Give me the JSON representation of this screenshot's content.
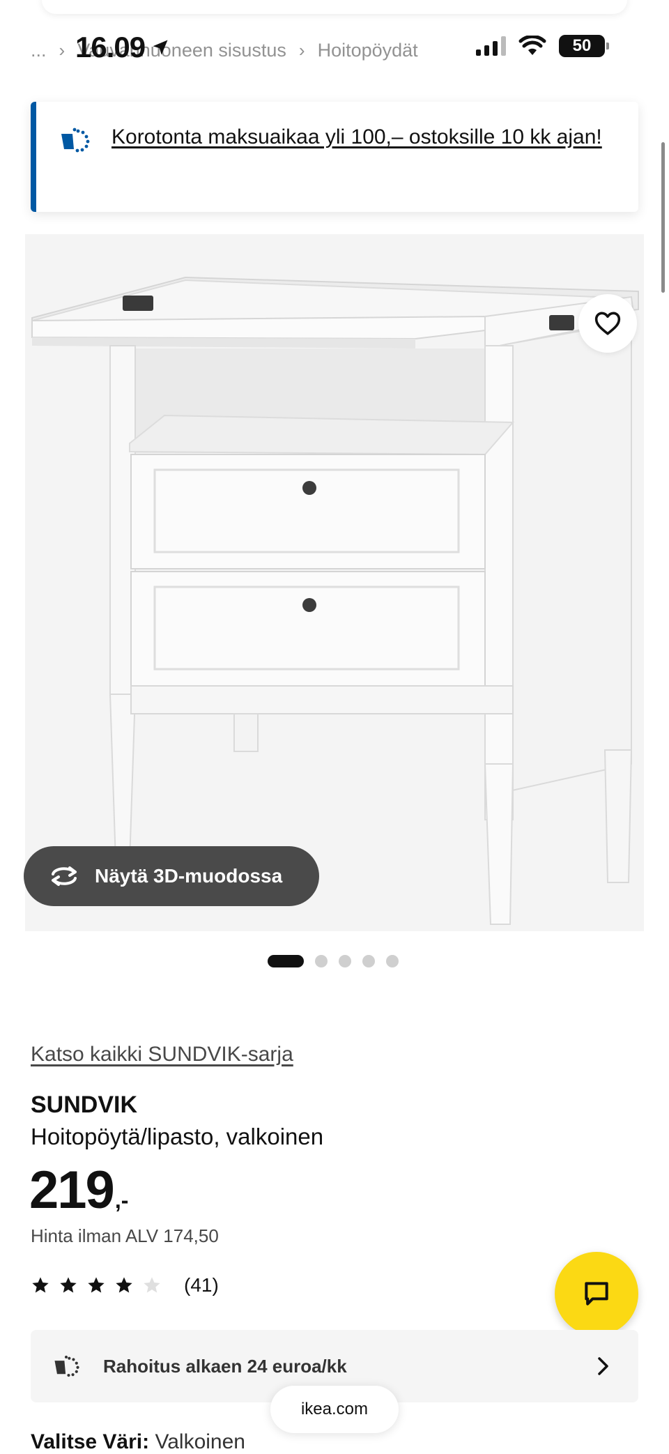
{
  "status_bar": {
    "time": "16.09",
    "battery": "50"
  },
  "breadcrumb": {
    "ellipsis": "...",
    "items": [
      "Vauvanhuoneen sisustus",
      "Hoitopöydät"
    ]
  },
  "promo": {
    "text": "Korotonta maksuaikaa yli 100,– ostoksille 10 kk ajan!",
    "icon": "payment-icon"
  },
  "gallery": {
    "view_3d_label": "Näytä 3D-muodossa",
    "dots_count": 5,
    "active_dot": 0
  },
  "product": {
    "series_link": "Katso kaikki SUNDVIK-sarja",
    "name": "SUNDVIK",
    "description": "Hoitopöytä/lipasto, valkoinen",
    "price_integer": "219",
    "price_decimal": ",-",
    "price_vat": "Hinta ilman ALV 174,50",
    "rating": 4,
    "rating_max": 5,
    "review_count": "(41)"
  },
  "finance": {
    "label": "Rahoitus alkaen 24 euroa/kk"
  },
  "browser": {
    "url": "ikea.com"
  },
  "color_select": {
    "label": "Valitse Väri:",
    "value": "Valkoinen"
  },
  "colors": {
    "accent_blue": "#0058a3",
    "chat_yellow": "#fbd914",
    "button_dark": "#4a4a4a"
  }
}
